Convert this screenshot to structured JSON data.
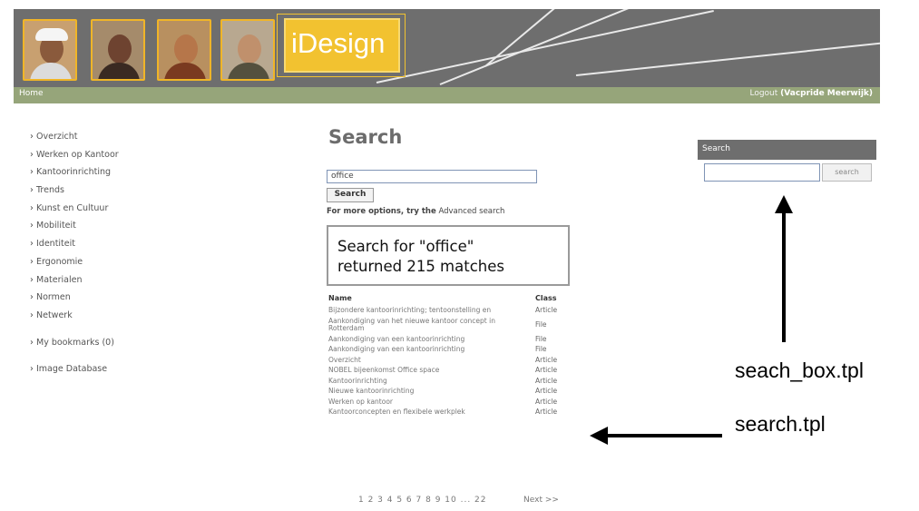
{
  "header": {
    "logo_text": "iDesign",
    "accent_color": "#f2c230",
    "banner_color": "#6e6e6e"
  },
  "navbar": {
    "home": "Home",
    "logout": "Logout",
    "user": "(Vacpride Meerwijk)"
  },
  "sidebar": {
    "items": [
      "Overzicht",
      "Werken op Kantoor",
      "Kantoorinrichting",
      "Trends",
      "Kunst en Cultuur",
      "Mobiliteit",
      "Identiteit",
      "Ergonomie",
      "Materialen",
      "Normen",
      "Netwerk"
    ],
    "bookmarks": "My bookmarks (0)",
    "image_db": "Image Database"
  },
  "main": {
    "title": "Search",
    "query": "office",
    "search_button": "Search",
    "more_options_lead": "For more options, try the",
    "advanced_link": "Advanced search",
    "result_line1": "Search for \"office\"",
    "result_line2": "returned 215 matches",
    "col_name": "Name",
    "col_class": "Class",
    "rows": [
      {
        "name": "Bijzondere kantoorinrichting; tentoonstelling en",
        "class": "Article"
      },
      {
        "name": "Aankondiging van het nieuwe kantoor concept in Rotterdam",
        "class": "File"
      },
      {
        "name": "Aankondiging van een kantoorinrichting",
        "class": "File"
      },
      {
        "name": "Aankondiging van een kantoorinrichting",
        "class": "File"
      },
      {
        "name": "Overzicht",
        "class": "Article"
      },
      {
        "name": "NOBEL bijeenkomst Office space",
        "class": "Article"
      },
      {
        "name": "Kantoorinrichting",
        "class": "Article"
      },
      {
        "name": "Nieuwe kantoorinrichting",
        "class": "Article"
      },
      {
        "name": "Werken op kantoor",
        "class": "Article"
      },
      {
        "name": "Kantoorconcepten en flexibele werkplek",
        "class": "Article"
      }
    ],
    "pager": "1 2 3 4 5 6 7 8 9 10 ... 22",
    "next": "Next >>"
  },
  "right_search": {
    "title": "Search",
    "button": "search"
  },
  "annotations": {
    "search_box_tpl": "seach_box.tpl",
    "search_tpl": "search.tpl"
  }
}
